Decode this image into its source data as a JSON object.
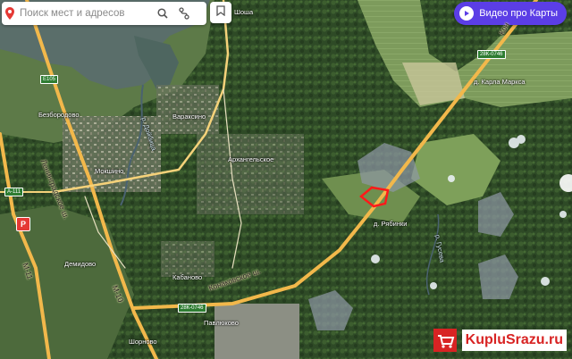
{
  "search": {
    "placeholder": "Поиск мест и адресов"
  },
  "video_button": {
    "label": "Видео про Карты"
  },
  "places": {
    "shosha": "Шоша",
    "varaksino": "Вараксино",
    "bezborodovo": "Безбородово",
    "moshino": "Мокшино",
    "arkhangelskoe": "Архангельское",
    "karla_marksa": "д. Карла Маркса",
    "ryabinki": "д. Рябинки",
    "demidovo": "Демидово",
    "kabanovo": "Кабаново",
    "pavlyukovo": "Павлюково",
    "shornovo": "Шорново"
  },
  "roads": {
    "leningradskoe": "Ленинградское ш.",
    "konakovskoe": "Конаковское ш.",
    "m10_a": "М-10",
    "m11": "М-11",
    "kon_top": "Кон",
    "river_doybitsa": "р. Дойбица",
    "river_gusevo": "р. Гусева"
  },
  "shields": {
    "e105": "E105",
    "a111": "А-111",
    "r28k_top": "28К-0746",
    "r28k_bottom": "28К-0746"
  },
  "watermark": {
    "text": "KupluSrazu.ru"
  },
  "colors": {
    "accent": "#5b3ee6",
    "plot_outline": "#ff1a1a",
    "brand_red": "#d82323",
    "road": "#f2b84b"
  },
  "icons": [
    "map-pin-icon",
    "search-icon",
    "route-icon",
    "bookmark-icon",
    "play-icon",
    "compass-icon"
  ]
}
